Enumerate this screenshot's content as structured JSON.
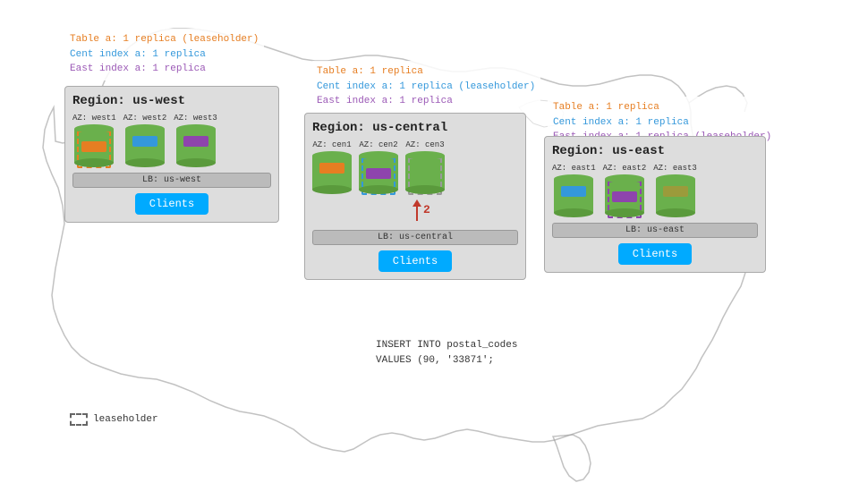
{
  "map": {
    "background": "#fff"
  },
  "info_west": {
    "line1": "Table a: 1 replica (leaseholder)",
    "line2": "Cent index a: 1 replica",
    "line3": "East index a: 1 replica"
  },
  "info_central": {
    "line1": "Table a: 1 replica",
    "line2": "Cent index a: 1 replica (leaseholder)",
    "line3": "East index a: 1 replica"
  },
  "info_east": {
    "line1": "Table a: 1 replica",
    "line2": "Cent index a: 1 replica",
    "line3": "East index a: 1 replica (leaseholder)"
  },
  "regions": {
    "west": {
      "title": "Region: us-west",
      "azs": [
        "AZ: west1",
        "AZ: west2",
        "AZ: west3"
      ],
      "lb": "LB: us-west",
      "clients": "Clients"
    },
    "central": {
      "title": "Region: us-central",
      "azs": [
        "AZ: cen1",
        "AZ: cen2",
        "AZ: cen3"
      ],
      "lb": "LB: us-central",
      "clients": "Clients"
    },
    "east": {
      "title": "Region: us-east",
      "azs": [
        "AZ: east1",
        "AZ: east2",
        "AZ: east3"
      ],
      "lb": "LB: us-east",
      "clients": "Clients"
    }
  },
  "arrow": {
    "label": "2"
  },
  "sql": {
    "line1": "INSERT INTO postal_codes",
    "line2": "VALUES (90, '33871';"
  },
  "legend": {
    "label": "leaseholder"
  }
}
